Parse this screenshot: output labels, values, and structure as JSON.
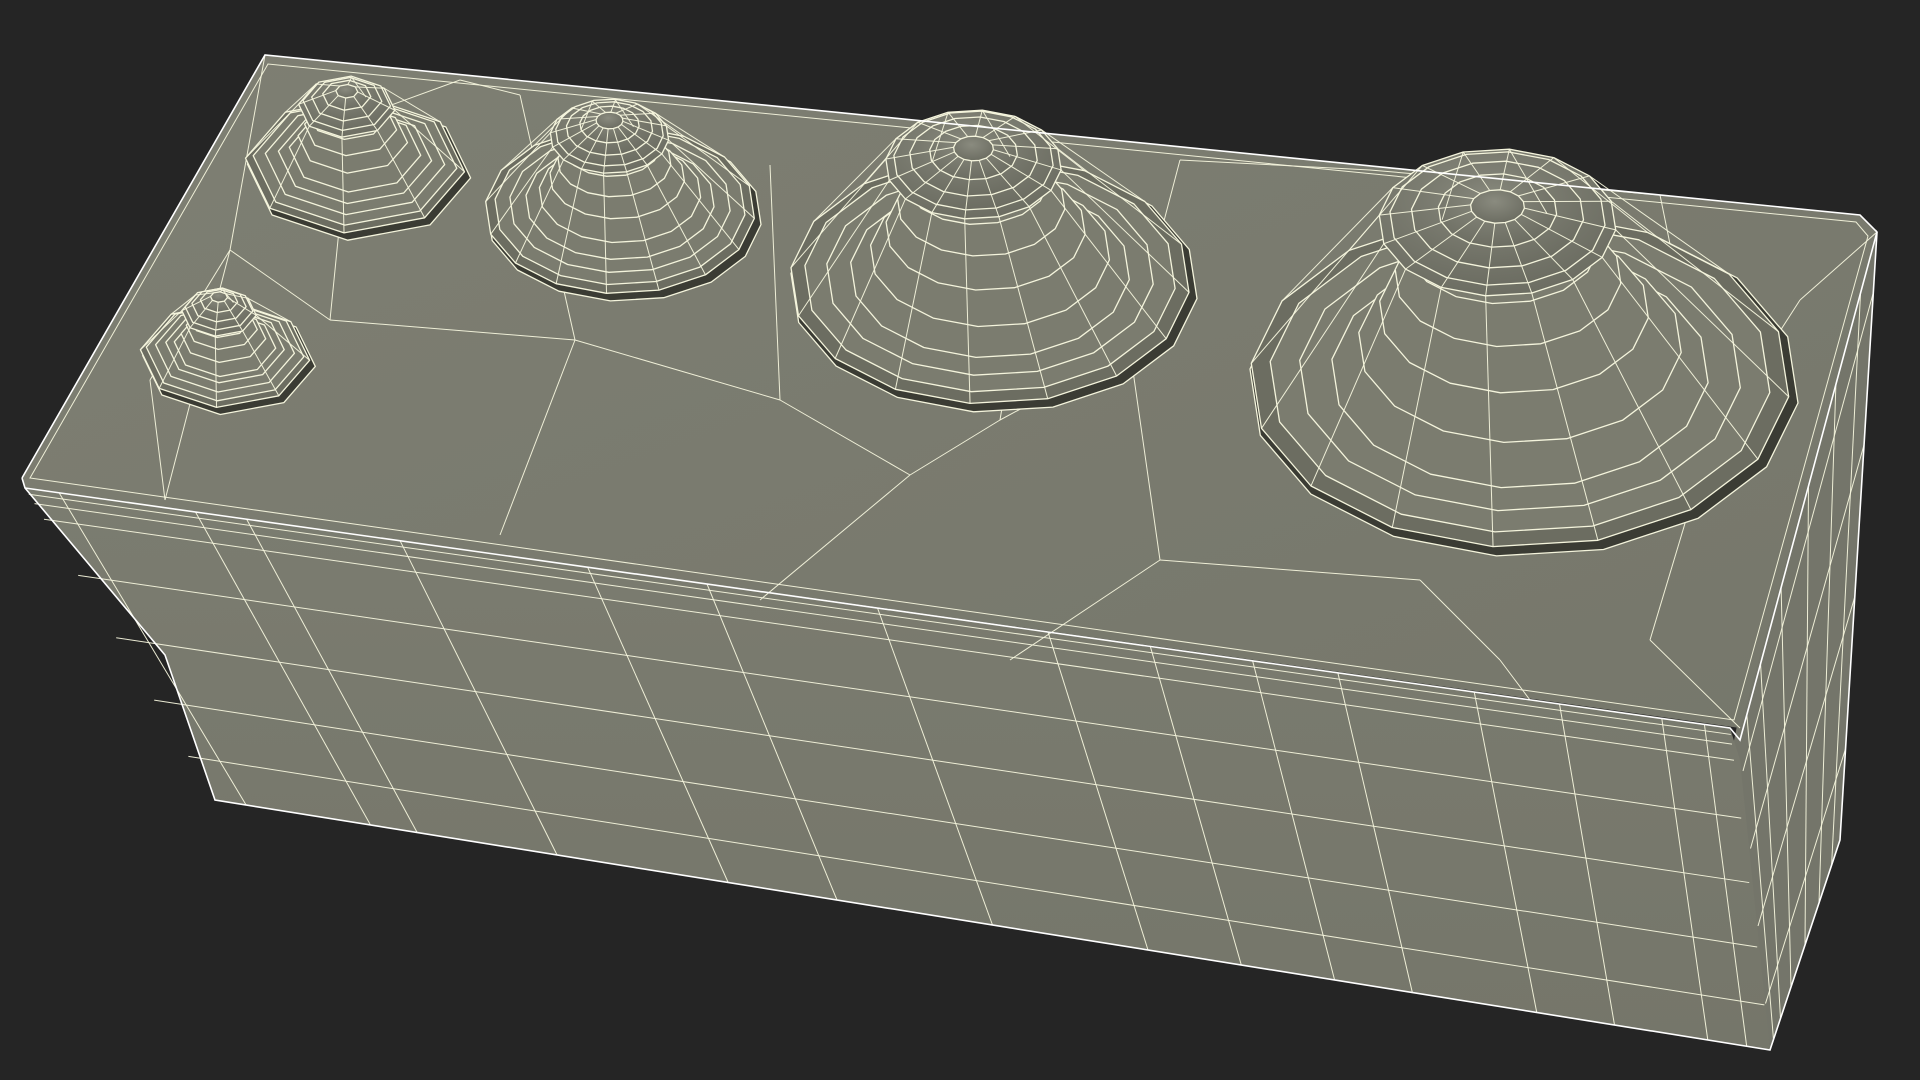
{
  "scene": {
    "background_color": "#252525",
    "mesh_fill": "#7b7c6f",
    "mesh_fill_dark": "#6c6d61",
    "mesh_fill_light": "#85867a",
    "shadow_color": "#3b3c34",
    "wire_color": "#f4f4dc",
    "object": "wireframe-box-with-knobs",
    "knob_count": 5
  }
}
